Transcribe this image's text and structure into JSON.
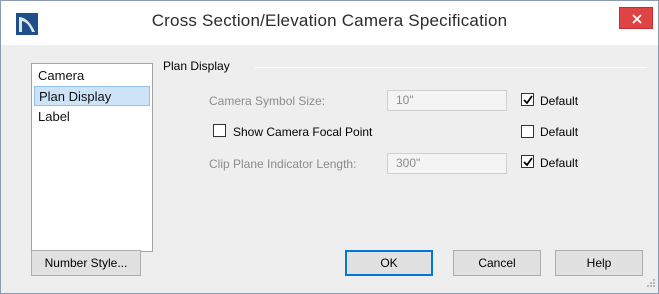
{
  "window": {
    "title": "Cross Section/Elevation Camera Specification"
  },
  "colors": {
    "close_button": "#e04343",
    "selection": "#cde4f8",
    "default_border": "#0078d7"
  },
  "sidebar": {
    "items": [
      {
        "label": "Camera"
      },
      {
        "label": "Plan Display"
      },
      {
        "label": "Label"
      }
    ],
    "selected_index": 1
  },
  "plan_display": {
    "group_title": "Plan Display",
    "camera_symbol_size": {
      "label": "Camera Symbol Size:",
      "value": "10\"",
      "default_label": "Default",
      "default_checked": true
    },
    "show_focal_point": {
      "label": "Show Camera Focal Point",
      "checked": false,
      "default_label": "Default",
      "default_checked": false
    },
    "clip_plane_length": {
      "label": "Clip Plane Indicator Length:",
      "value": "300\"",
      "default_label": "Default",
      "default_checked": true
    }
  },
  "buttons": {
    "number_style": "Number Style...",
    "ok": "OK",
    "cancel": "Cancel",
    "help": "Help"
  },
  "icons": {
    "app": "app-logo-icon",
    "close": "close-icon",
    "check": "checkmark-icon",
    "grip": "resize-grip-icon"
  }
}
